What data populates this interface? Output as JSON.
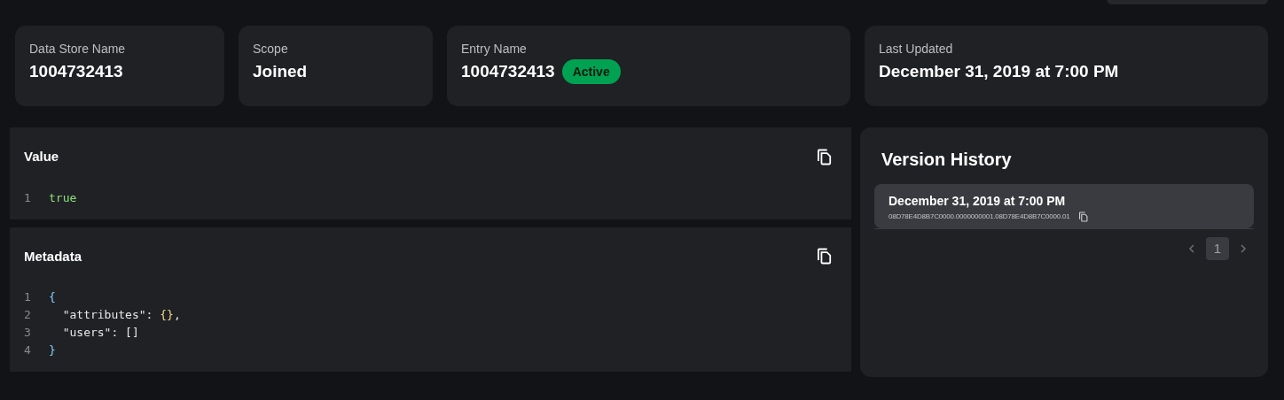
{
  "summary_cards": [
    {
      "label": "Data Store Name",
      "value": "1004732413"
    },
    {
      "label": "Scope",
      "value": "Joined"
    },
    {
      "label": "Entry Name",
      "value": "1004732413",
      "badge": "Active"
    },
    {
      "label": "Last Updated",
      "value": "December 31, 2019 at 7:00 PM"
    }
  ],
  "panels": [
    {
      "title": "Value",
      "lines": [
        {
          "number": "1",
          "tokens": [
            {
              "kind": "boolean",
              "text": "true"
            }
          ]
        }
      ]
    },
    {
      "title": "Metadata",
      "lines": [
        {
          "number": "1",
          "tokens": [
            {
              "kind": "punct",
              "text": "{"
            }
          ]
        },
        {
          "number": "2",
          "tokens": [
            {
              "kind": "key",
              "text": "  \"attributes\""
            },
            {
              "kind": "plain",
              "text": ": "
            },
            {
              "kind": "brace",
              "text": "{}"
            },
            {
              "kind": "plain",
              "text": ","
            }
          ]
        },
        {
          "number": "3",
          "tokens": [
            {
              "kind": "key",
              "text": "  \"users\""
            },
            {
              "kind": "plain",
              "text": ": "
            },
            {
              "kind": "plain",
              "text": "[]"
            }
          ]
        },
        {
          "number": "4",
          "tokens": [
            {
              "kind": "punct",
              "text": "}"
            }
          ]
        }
      ]
    }
  ],
  "version_history": {
    "title": "Version History",
    "versions": [
      {
        "date": "December 31, 2019 at 7:00 PM",
        "id": "08D78E4D8B7C0000.0000000001.08D78E4D8B7C0000.01"
      }
    ],
    "pages": [
      {
        "label": "1",
        "selected": true
      }
    ]
  }
}
